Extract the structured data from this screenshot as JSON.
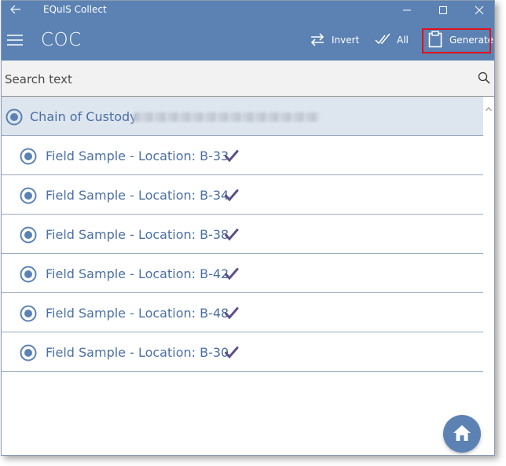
{
  "window": {
    "title": "EQuIS Collect"
  },
  "appbar": {
    "title": "COC",
    "commands": [
      {
        "label": "Invert",
        "icon": "swap-arrows-icon"
      },
      {
        "label": "All",
        "icon": "double-check-icon"
      },
      {
        "label": "Generate",
        "icon": "clipboard-icon"
      }
    ]
  },
  "search": {
    "placeholder": "Search text"
  },
  "group": {
    "label": "Chain of Custody"
  },
  "items": [
    {
      "label": "Field Sample - Location: B-33"
    },
    {
      "label": "Field Sample - Location: B-34"
    },
    {
      "label": "Field Sample - Location: B-38"
    },
    {
      "label": "Field Sample - Location: B-42"
    },
    {
      "label": "Field Sample - Location: B-48"
    },
    {
      "label": "Field Sample - Location: B-30"
    }
  ],
  "colors": {
    "accent": "#5b82b3",
    "text": "#4a6fa5",
    "check": "#5b4f8c",
    "highlight": "#e3101b"
  }
}
